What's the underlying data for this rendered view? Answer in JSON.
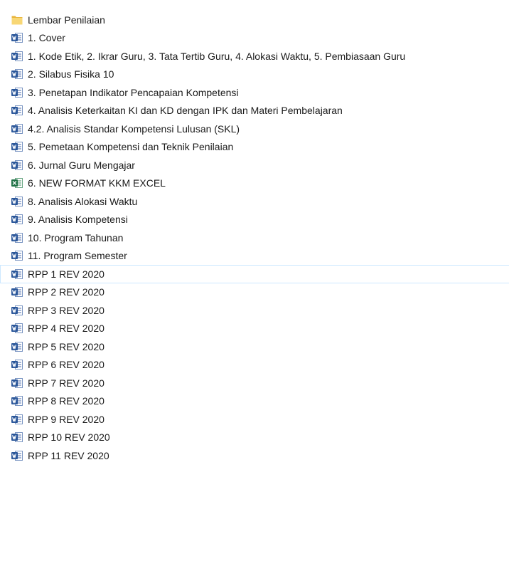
{
  "explorer": {
    "colors": {
      "folder": "#f4c553",
      "word": "#2b579a",
      "excel": "#1e7145",
      "hover_border": "#cde8ff"
    },
    "items": [
      {
        "name": "Lembar Penilaian",
        "icon": "folder-icon",
        "type": "folder"
      },
      {
        "name": "1. Cover",
        "icon": "word-doc-icon",
        "type": "word"
      },
      {
        "name": "1. Kode Etik, 2. Ikrar Guru, 3. Tata Tertib Guru, 4. Alokasi Waktu, 5. Pembiasaan Guru",
        "icon": "word-doc-icon",
        "type": "word"
      },
      {
        "name": "2. Silabus Fisika 10",
        "icon": "word-doc-icon",
        "type": "word"
      },
      {
        "name": "3. Penetapan Indikator Pencapaian Kompetensi",
        "icon": "word-doc-icon",
        "type": "word"
      },
      {
        "name": "4. Analisis Keterkaitan KI dan KD dengan IPK dan Materi Pembelajaran",
        "icon": "word-doc-icon",
        "type": "word"
      },
      {
        "name": "4.2. Analisis Standar Kompetensi Lulusan (SKL)",
        "icon": "word-doc-icon",
        "type": "word"
      },
      {
        "name": "5. Pemetaan Kompetensi dan Teknik Penilaian",
        "icon": "word-doc-icon",
        "type": "word"
      },
      {
        "name": "6. Jurnal Guru Mengajar",
        "icon": "word-doc-icon",
        "type": "word"
      },
      {
        "name": "6. NEW FORMAT KKM EXCEL",
        "icon": "excel-sheet-icon",
        "type": "excel"
      },
      {
        "name": "8. Analisis Alokasi Waktu",
        "icon": "word-doc-icon",
        "type": "word"
      },
      {
        "name": "9. Analisis Kompetensi",
        "icon": "word-doc-icon",
        "type": "word"
      },
      {
        "name": "10. Program Tahunan",
        "icon": "word-doc-icon",
        "type": "word"
      },
      {
        "name": "11. Program Semester",
        "icon": "word-doc-icon",
        "type": "word"
      },
      {
        "name": "RPP 1 REV 2020",
        "icon": "word-doc-icon",
        "type": "word",
        "hovered": true
      },
      {
        "name": "RPP 2 REV 2020",
        "icon": "word-doc-icon",
        "type": "word"
      },
      {
        "name": "RPP 3 REV 2020",
        "icon": "word-doc-icon",
        "type": "word"
      },
      {
        "name": "RPP 4 REV 2020",
        "icon": "word-doc-icon",
        "type": "word"
      },
      {
        "name": "RPP 5 REV 2020",
        "icon": "word-doc-icon",
        "type": "word"
      },
      {
        "name": "RPP 6 REV 2020",
        "icon": "word-doc-icon",
        "type": "word"
      },
      {
        "name": "RPP 7 REV 2020",
        "icon": "word-doc-icon",
        "type": "word"
      },
      {
        "name": "RPP 8 REV 2020",
        "icon": "word-doc-icon",
        "type": "word"
      },
      {
        "name": "RPP 9 REV 2020",
        "icon": "word-doc-icon",
        "type": "word"
      },
      {
        "name": "RPP 10 REV 2020",
        "icon": "word-doc-icon",
        "type": "word"
      },
      {
        "name": "RPP 11 REV 2020",
        "icon": "word-doc-icon",
        "type": "word"
      }
    ]
  }
}
